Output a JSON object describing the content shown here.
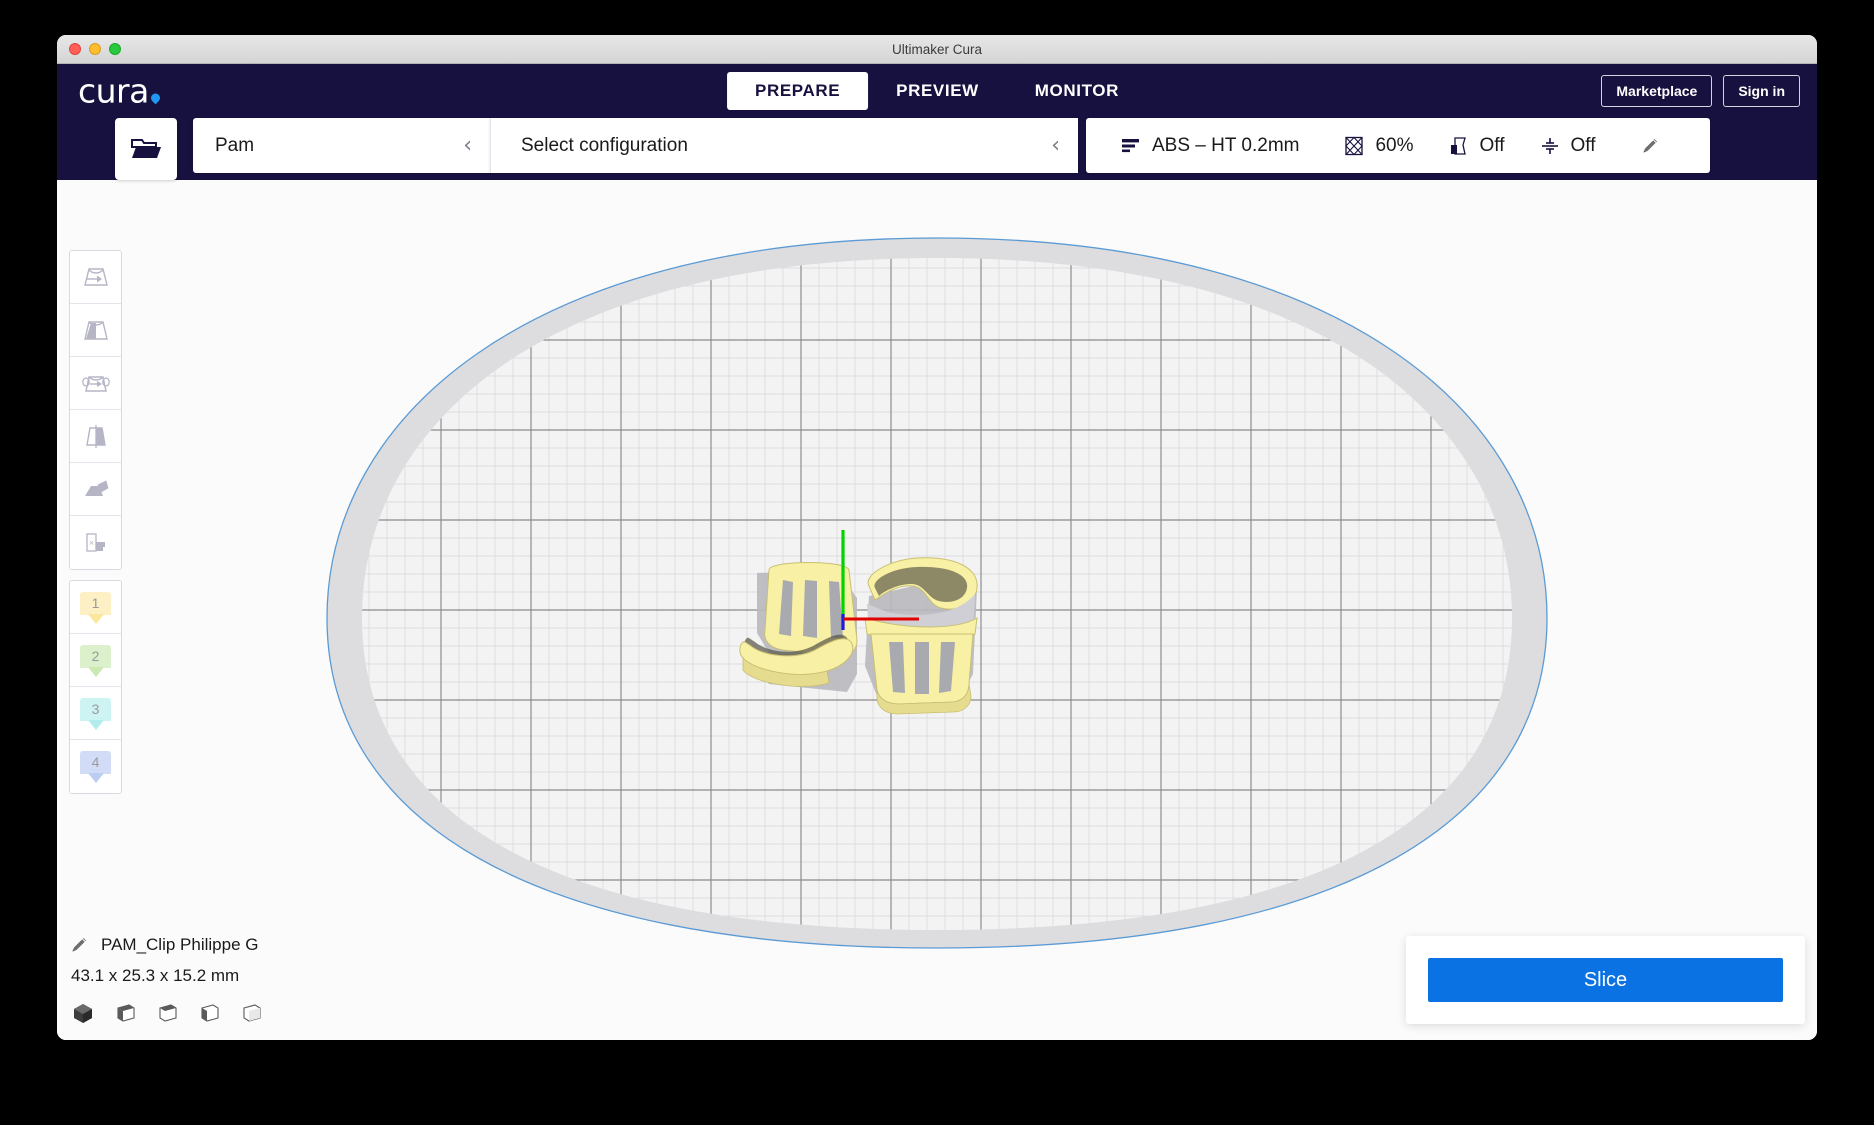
{
  "window": {
    "title": "Ultimaker Cura",
    "controls": [
      "close",
      "minimize",
      "maximize"
    ]
  },
  "branding": {
    "logo_text": "cura",
    "accent_color": "#2196f3",
    "header_bg": "#17113f"
  },
  "topnav": {
    "tabs": [
      {
        "label": "PREPARE",
        "active": true
      },
      {
        "label": "PREVIEW",
        "active": false
      },
      {
        "label": "MONITOR",
        "active": false
      }
    ],
    "marketplace_label": "Marketplace",
    "signin_label": "Sign in"
  },
  "toolbar": {
    "open_file_icon": "open-folder-icon",
    "machine": {
      "label": "Pam",
      "chevron": "‹"
    },
    "configuration": {
      "label": "Select configuration",
      "chevron": "‹"
    },
    "print_setup": {
      "profile_icon": "layer-height-icon",
      "profile_label": "ABS – HT 0.2mm",
      "infill_icon": "infill-icon",
      "infill_value": "60%",
      "support_icon": "support-icon",
      "support_value": "Off",
      "adhesion_icon": "adhesion-icon",
      "adhesion_value": "Off",
      "custom_icon": "pencil-icon"
    }
  },
  "tools": [
    {
      "name": "move-tool",
      "label": "Move"
    },
    {
      "name": "scale-tool",
      "label": "Scale"
    },
    {
      "name": "rotate-tool",
      "label": "Rotate"
    },
    {
      "name": "mirror-tool",
      "label": "Mirror"
    },
    {
      "name": "per-model-settings-tool",
      "label": "Per Model Settings"
    },
    {
      "name": "support-blocker-tool",
      "label": "Support Blocker"
    }
  ],
  "extruders": [
    {
      "number": "1",
      "color": "#fdf0c4",
      "tip_color": "#fbe79b"
    },
    {
      "number": "2",
      "color": "#dcf0cb",
      "tip_color": "#cbe9b2"
    },
    {
      "number": "3",
      "color": "#cdf3f3",
      "tip_color": "#b3ecec"
    },
    {
      "number": "4",
      "color": "#d2dcf6",
      "tip_color": "#bccdf2"
    }
  ],
  "model": {
    "edit_icon": "pencil-icon",
    "name": "PAM_Clip Philippe G",
    "dimensions": "43.1 x 25.3 x 15.2 mm",
    "view_modes": [
      {
        "name": "view-3d-icon",
        "active": true
      },
      {
        "name": "view-front-icon",
        "active": false
      },
      {
        "name": "view-top-icon",
        "active": false
      },
      {
        "name": "view-left-icon",
        "active": false
      },
      {
        "name": "view-right-icon",
        "active": false
      }
    ]
  },
  "actions": {
    "slice_label": "Slice",
    "slice_color": "#0a72e2"
  },
  "build_plate": {
    "outline_color": "#5b9bd5",
    "disallowed_color": "#c9c9cd",
    "grid_major_color": "#8a8a8a",
    "grid_minor_color": "#d3d3d6"
  },
  "scene": {
    "model_color": "#f8f0a4",
    "model_shadow": "#b9b9bf",
    "axis_y_color": "#00d400",
    "axis_x_color": "#e00000",
    "axis_z_color": "#1a1ae0",
    "object_count": 2
  }
}
